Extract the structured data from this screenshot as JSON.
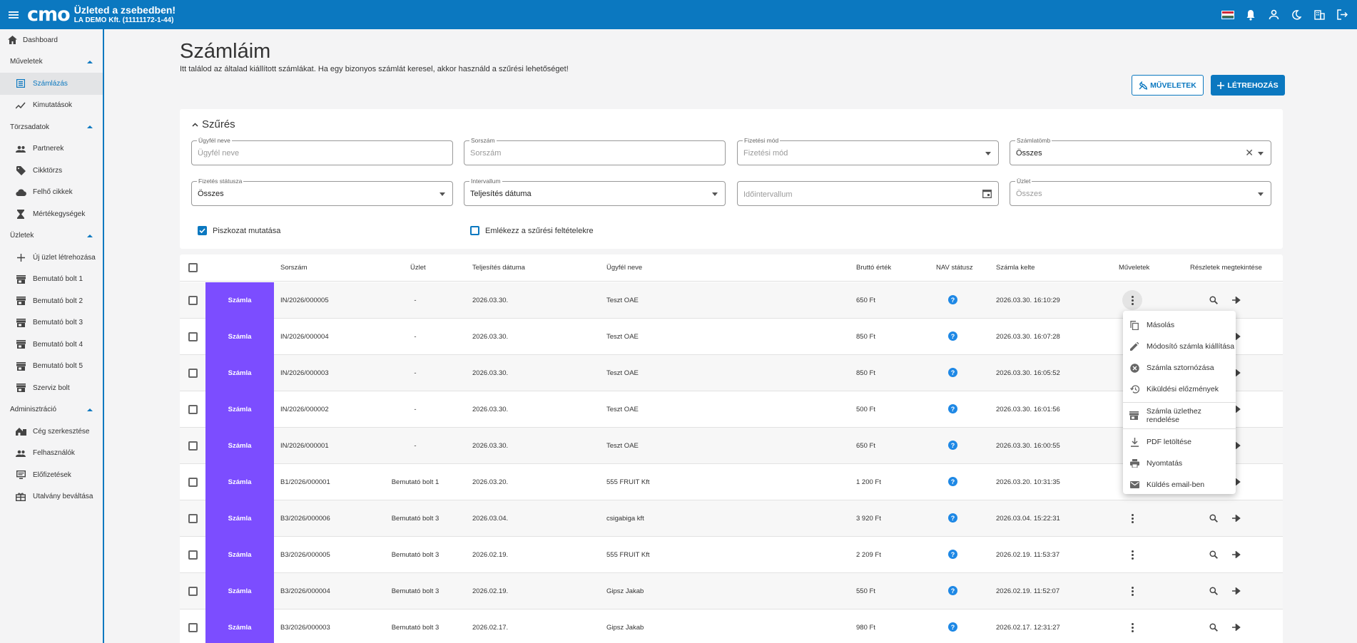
{
  "topbar": {
    "logo": "cmo",
    "slogan": "Üzleted a zsebedben!",
    "company": "LA DEMO Kft. (11111172-1-44)"
  },
  "sidebar": {
    "dashboard": "Dashboard",
    "sections": [
      {
        "label": "Műveletek",
        "items": [
          "Számlázás",
          "Kimutatások"
        ]
      },
      {
        "label": "Törzsadatok",
        "items": [
          "Partnerek",
          "Cikktörzs",
          "Felhő cikkek",
          "Mértékegységek"
        ]
      },
      {
        "label": "Üzletek",
        "items": [
          "Új üzlet létrehozása",
          "Bemutató bolt 1",
          "Bemutató bolt 2",
          "Bemutató bolt 3",
          "Bemutató bolt 4",
          "Bemutató bolt 5",
          "Szerviz bolt"
        ]
      },
      {
        "label": "Adminisztráció",
        "items": [
          "Cég szerkesztése",
          "Felhasználók",
          "Előfizetések",
          "Utalvány beváltása"
        ]
      }
    ],
    "active": "Számlázás"
  },
  "page": {
    "title": "Számláim",
    "description": "Itt találod az általad kiállított számlákat. Ha egy bizonyos számlát keresel, akkor használd a szűrési lehetőséget!",
    "actions_button": "MŰVELETEK",
    "create_button": "LÉTREHOZÁS"
  },
  "filter": {
    "title": "Szűrés",
    "customer": {
      "label": "Ügyfél neve",
      "placeholder": "Ügyfél neve"
    },
    "serial": {
      "label": "Sorszám",
      "placeholder": "Sorszám"
    },
    "payment_method": {
      "label": "Fizetési mód",
      "placeholder": "Fizetési mód"
    },
    "invoice_block": {
      "label": "Számlatömb",
      "value": "Összes"
    },
    "payment_status": {
      "label": "Fizetés státusza",
      "value": "Összes"
    },
    "interval": {
      "label": "Intervallum",
      "value": "Teljesítés dátuma"
    },
    "time_interval": {
      "placeholder": "Időintervallum"
    },
    "store": {
      "label": "Üzlet",
      "placeholder": "Összes"
    },
    "show_drafts": {
      "label": "Piszkozat mutatása",
      "checked": true
    },
    "remember": {
      "label": "Emlékezz a szűrési feltételekre",
      "checked": false
    }
  },
  "table": {
    "headers": {
      "serial": "Sorszám",
      "store": "Üzlet",
      "fulfillment": "Teljesítés dátuma",
      "customer": "Ügyfél neve",
      "gross": "Bruttó érték",
      "nav": "NAV státusz",
      "issued": "Számla kelte",
      "operations": "Műveletek",
      "details": "Részletek megtekintése"
    },
    "rows": [
      {
        "type": "Számla",
        "serial": "IN/2026/000005",
        "store": "-",
        "date": "2026.03.30.",
        "customer": "Teszt OAE",
        "gross": "650 Ft",
        "nav": "?",
        "issued": "2026.03.30. 16:10:29"
      },
      {
        "type": "Számla",
        "serial": "IN/2026/000004",
        "store": "-",
        "date": "2026.03.30.",
        "customer": "Teszt OAE",
        "gross": "850 Ft",
        "nav": "?",
        "issued": "2026.03.30. 16:07:28"
      },
      {
        "type": "Számla",
        "serial": "IN/2026/000003",
        "store": "-",
        "date": "2026.03.30.",
        "customer": "Teszt OAE",
        "gross": "850 Ft",
        "nav": "?",
        "issued": "2026.03.30. 16:05:52"
      },
      {
        "type": "Számla",
        "serial": "IN/2026/000002",
        "store": "-",
        "date": "2026.03.30.",
        "customer": "Teszt OAE",
        "gross": "500 Ft",
        "nav": "?",
        "issued": "2026.03.30. 16:01:56"
      },
      {
        "type": "Számla",
        "serial": "IN/2026/000001",
        "store": "-",
        "date": "2026.03.30.",
        "customer": "Teszt OAE",
        "gross": "650 Ft",
        "nav": "?",
        "issued": "2026.03.30. 16:00:55"
      },
      {
        "type": "Számla",
        "serial": "B1/2026/000001",
        "store": "Bemutató bolt 1",
        "date": "2026.03.20.",
        "customer": "555 FRUIT Kft",
        "gross": "1 200 Ft",
        "nav": "?",
        "issued": "2026.03.20. 10:31:35"
      },
      {
        "type": "Számla",
        "serial": "B3/2026/000006",
        "store": "Bemutató bolt 3",
        "date": "2026.03.04.",
        "customer": "csigabiga kft",
        "gross": "3 920 Ft",
        "nav": "?",
        "issued": "2026.03.04. 15:22:31"
      },
      {
        "type": "Számla",
        "serial": "B3/2026/000005",
        "store": "Bemutató bolt 3",
        "date": "2026.02.19.",
        "customer": "555 FRUIT Kft",
        "gross": "2 209 Ft",
        "nav": "?",
        "issued": "2026.02.19. 11:53:37"
      },
      {
        "type": "Számla",
        "serial": "B3/2026/000004",
        "store": "Bemutató bolt 3",
        "date": "2026.02.19.",
        "customer": "Gipsz Jakab",
        "gross": "550 Ft",
        "nav": "?",
        "issued": "2026.02.19. 11:52:07"
      },
      {
        "type": "Számla",
        "serial": "B3/2026/000003",
        "store": "Bemutató bolt 3",
        "date": "2026.02.17.",
        "customer": "Gipsz Jakab",
        "gross": "980 Ft",
        "nav": "?",
        "issued": "2026.02.17. 12:31:27"
      }
    ]
  },
  "context_menu": {
    "items": [
      {
        "label": "Másolás",
        "icon": "copy-icon"
      },
      {
        "label": "Módosító számla kiállítása",
        "icon": "pencil-icon"
      },
      {
        "label": "Számla sztornózása",
        "icon": "cancel-icon"
      },
      {
        "label": "Kiküldési előzmények",
        "icon": "history-icon"
      },
      {
        "label": "Számla üzlethez rendelése",
        "icon": "store-icon"
      },
      {
        "label": "PDF letöltése",
        "icon": "download-icon"
      },
      {
        "label": "Nyomtatás",
        "icon": "print-icon"
      },
      {
        "label": "Küldés email-ben",
        "icon": "email-icon"
      }
    ]
  },
  "colors": {
    "primary": "#0b78c0",
    "invoice_badge": "#7c4dff",
    "nav_status": "#1e88e5"
  }
}
